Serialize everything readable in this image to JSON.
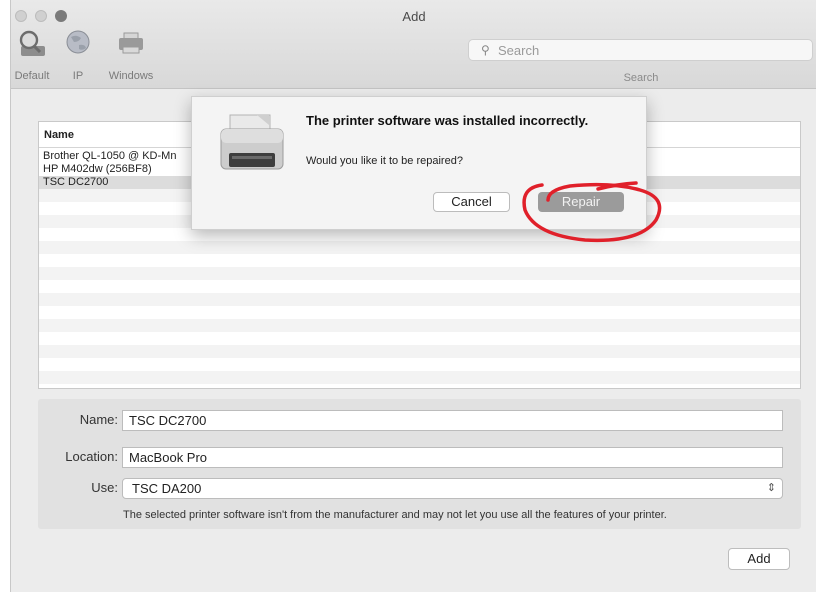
{
  "window": {
    "title": "Add"
  },
  "toolbar": {
    "tools": [
      {
        "label": "Default",
        "icon": "magnifier-printer-icon"
      },
      {
        "label": "IP",
        "icon": "globe-icon"
      },
      {
        "label": "Windows",
        "icon": "windows-printer-icon"
      }
    ],
    "search": {
      "placeholder": "Search",
      "label": "Search"
    }
  },
  "printer_list": {
    "column_header": "Name",
    "rows": [
      "Brother QL-1050 @ KD-Mn",
      "HP M402dw (256BF8)",
      "TSC DC2700"
    ],
    "selected": "TSC DC2700"
  },
  "form": {
    "name_label": "Name:",
    "name_value": "TSC DC2700",
    "location_label": "Location:",
    "location_value": "MacBook Pro",
    "use_label": "Use:",
    "use_value": "TSC DA200",
    "note": "The selected printer software isn't from the manufacturer and may not let you use all the features of your printer.",
    "add_label": "Add"
  },
  "dialog": {
    "title": "The printer software was installed incorrectly.",
    "message": "Would you like it to be repaired?",
    "cancel_label": "Cancel",
    "repair_label": "Repair",
    "icon": "printer-icon"
  },
  "colors": {
    "annotation": "#e0202a",
    "selected_row": "#dcdcdc",
    "repair_button": "#9b9b9b"
  }
}
